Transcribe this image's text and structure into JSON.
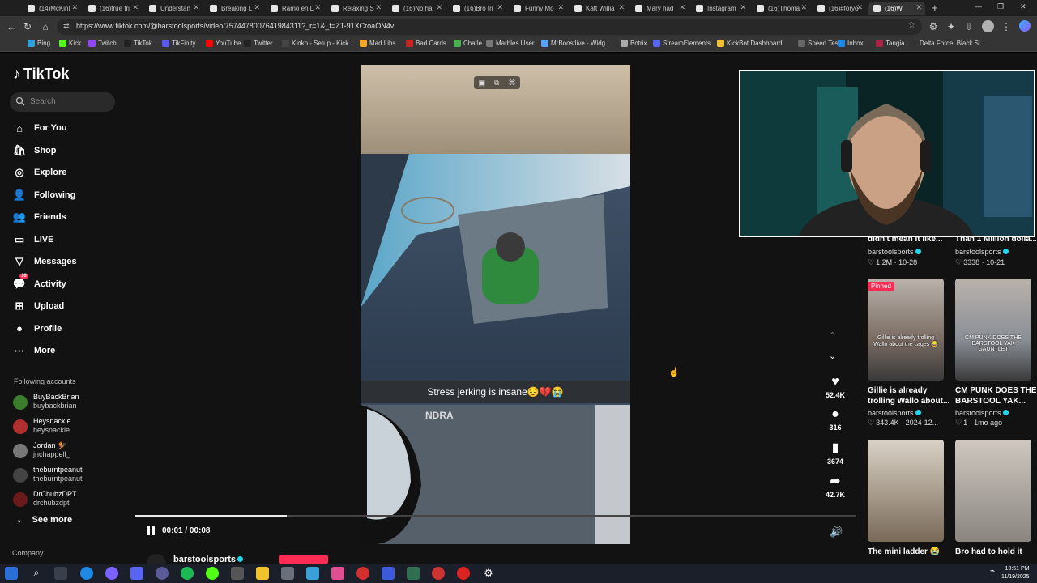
{
  "browser": {
    "tabs": [
      {
        "label": "(14)McKinl"
      },
      {
        "label": "(16)true fri"
      },
      {
        "label": "Understan"
      },
      {
        "label": "Breaking L"
      },
      {
        "label": "Ramo en L"
      },
      {
        "label": "Relaxing S"
      },
      {
        "label": "(16)No ha"
      },
      {
        "label": "(16)Bro tri"
      },
      {
        "label": "Funny Mo"
      },
      {
        "label": "Katt Willia"
      },
      {
        "label": "Mary had"
      },
      {
        "label": "Instagram"
      },
      {
        "label": "(16)Thoma"
      },
      {
        "label": "(16)#foryo"
      },
      {
        "label": "(16)W"
      }
    ],
    "url": "https://www.tiktok.com/@barstoolsports/video/7574478007641984311?_r=1&_t=ZT-91XCroaON4v",
    "bookmarks": [
      "Bing",
      "Kick",
      "Twitch",
      "TikTok",
      "TikFinity",
      "YouTube",
      "Twitter",
      "Kinko - Setup - Kick...",
      "Mad Libs",
      "Bad Cards",
      "Chatle",
      "Marbles User",
      "MrBoostlive - Widg...",
      "Botrix",
      "StreamElements",
      "KickBot Dashboard",
      "Speed Test",
      "Inbox",
      "Tangia",
      "Delta Force: Black Si..."
    ]
  },
  "sidebar": {
    "logo": "TikTok",
    "search_placeholder": "Search",
    "nav": [
      {
        "label": "For You",
        "icon": "home-icon"
      },
      {
        "label": "Shop",
        "icon": "shop-icon"
      },
      {
        "label": "Explore",
        "icon": "compass-icon"
      },
      {
        "label": "Following",
        "icon": "following-icon"
      },
      {
        "label": "Friends",
        "icon": "friends-icon"
      },
      {
        "label": "LIVE",
        "icon": "live-icon"
      },
      {
        "label": "Messages",
        "icon": "messages-icon"
      },
      {
        "label": "Activity",
        "icon": "activity-icon",
        "badge": "16"
      },
      {
        "label": "Upload",
        "icon": "upload-icon"
      },
      {
        "label": "Profile",
        "icon": "profile-icon"
      },
      {
        "label": "More",
        "icon": "more-icon"
      }
    ],
    "following_title": "Following accounts",
    "accounts": [
      {
        "name": "BuyBackBrian",
        "handle": "buybackbrian",
        "color": "#3a7d2c"
      },
      {
        "name": "Heysnackle",
        "handle": "heysnackle",
        "color": "#b03030"
      },
      {
        "name": "Jordan 🐓",
        "handle": "jnchappell_",
        "color": "#777777"
      },
      {
        "name": "theburntpeanut",
        "handle": "theburntpeanut",
        "color": "#444444"
      },
      {
        "name": "DrChubzDPT",
        "handle": "drchubzdpt",
        "color": "#6a1a1a"
      }
    ],
    "see_more": "See more",
    "company": "Company"
  },
  "video": {
    "caption": "Stress jerking is insane😔💔😭",
    "time": "00:01 / 00:08",
    "progress": 0.21,
    "author": "barstoolsports"
  },
  "actions": {
    "likes": "52.4K",
    "comments": "316",
    "saves": "3674",
    "shares": "42.7K"
  },
  "related": [
    {
      "title": "didn't mean it like...",
      "user": "barstoolsports",
      "meta": "1.2M · 10-28"
    },
    {
      "title": "Than 1 Million dolla...",
      "user": "barstoolsports",
      "meta": "3338 · 10-21"
    },
    {
      "title": "Gillie is already trolling Wallo about...",
      "title1": "Gillie is already",
      "title2": "trolling Wallo about...",
      "user": "barstoolsports",
      "meta": "343.4K · 2024-12...",
      "pinned": "Pinned",
      "thumb_caption": "Gillie is already trolling Wallo about the cages 😂"
    },
    {
      "title": "CM PUNK DOES THE BARSTOOL YAK...",
      "title1": "CM PUNK DOES THE",
      "title2": "BARSTOOL YAK...",
      "user": "barstoolsports",
      "meta": "1 · 1mo ago",
      "thumb_caption": "CM PUNK DOES THE BARSTOOL YAK GAUNTLET"
    },
    {
      "title": "The mini ladder 😭",
      "user": "",
      "meta": ""
    },
    {
      "title": "Bro had to hold it",
      "user": "",
      "meta": ""
    }
  ],
  "taskbar": {
    "time": "10:51 PM",
    "date": "11/19/2025"
  }
}
